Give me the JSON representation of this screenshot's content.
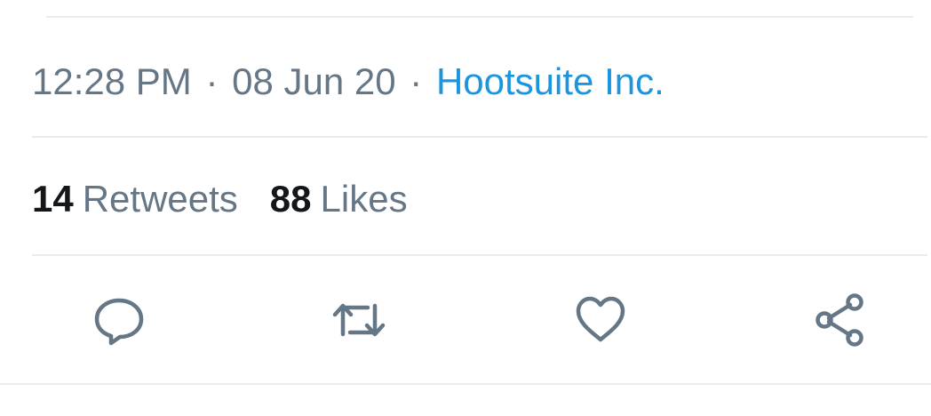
{
  "tweet_meta": {
    "time": "12:28 PM",
    "separator": "·",
    "date": "08 Jun 20",
    "source": "Hootsuite Inc."
  },
  "stats": {
    "retweets_count": "14",
    "retweets_label": "Retweets",
    "likes_count": "88",
    "likes_label": "Likes"
  },
  "actions": [
    {
      "name": "reply",
      "icon": "speech-bubble-icon"
    },
    {
      "name": "retweet",
      "icon": "retweet-arrows-icon"
    },
    {
      "name": "like",
      "icon": "heart-icon"
    },
    {
      "name": "share",
      "icon": "share-nodes-icon"
    }
  ],
  "colors": {
    "text_secondary": "#657786",
    "text_primary": "#14171a",
    "link": "#1b95e0",
    "divider": "#e6ecf0",
    "icon": "#657786"
  }
}
